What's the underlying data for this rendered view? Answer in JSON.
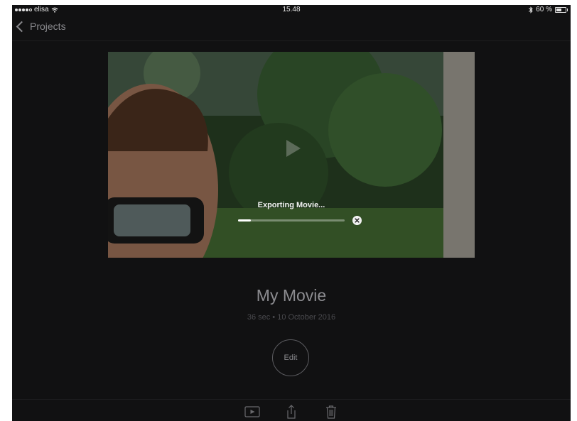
{
  "status_bar": {
    "carrier": "elisa",
    "time": "15.48",
    "battery_text": "60 %",
    "battery_level": 0.6
  },
  "nav": {
    "back_label": "Projects"
  },
  "preview": {
    "export_label": "Exporting Movie...",
    "export_progress": 0.12
  },
  "movie": {
    "title": "My Movie",
    "meta": "36 sec • 10 October 2016"
  },
  "actions": {
    "edit_label": "Edit"
  },
  "icons": {
    "back": "chevron-left-icon",
    "play": "play-icon",
    "cancel": "close-circle-icon",
    "toolbar_play": "play-icon",
    "share": "share-icon",
    "trash": "trash-icon"
  },
  "colors": {
    "background": "#111112",
    "muted_text": "#8a8a8e",
    "title_text": "#8c8c90"
  }
}
